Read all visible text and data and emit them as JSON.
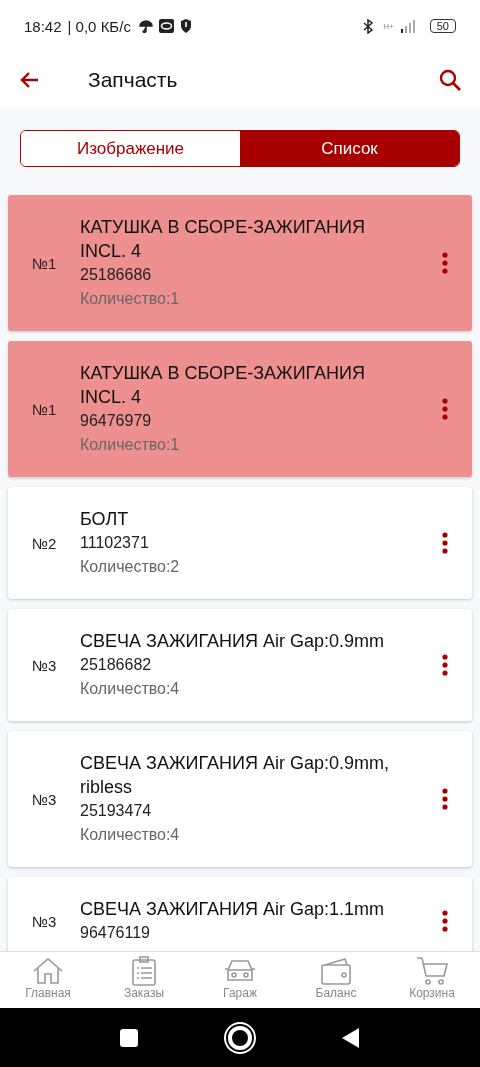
{
  "status_bar": {
    "time": "18:42",
    "speed": "| 0,0 КБ/с",
    "battery": "50",
    "network": "H+"
  },
  "app_bar": {
    "title": "Запчасть"
  },
  "tabs": [
    {
      "label": "Изображение",
      "selected": false
    },
    {
      "label": "Список",
      "selected": true
    }
  ],
  "parts": [
    {
      "number": "№1",
      "name": "КАТУШКА В СБОРЕ-ЗАЖИГАНИЯ INCL. 4",
      "code": "25186686",
      "quantity": "Количество:1",
      "highlighted": true
    },
    {
      "number": "№1",
      "name": "КАТУШКА В СБОРЕ-ЗАЖИГАНИЯ INCL. 4",
      "code": "96476979",
      "quantity": "Количество:1",
      "highlighted": true
    },
    {
      "number": "№2",
      "name": "БОЛТ",
      "code": "11102371",
      "quantity": "Количество:2",
      "highlighted": false
    },
    {
      "number": "№3",
      "name": "СВЕЧА ЗАЖИГАНИЯ Air Gap:0.9mm",
      "code": "25186682",
      "quantity": "Количество:4",
      "highlighted": false
    },
    {
      "number": "№3",
      "name": "СВЕЧА ЗАЖИГАНИЯ Air Gap:0.9mm, ribless",
      "code": "25193474",
      "quantity": "Количество:4",
      "highlighted": false
    },
    {
      "number": "№3",
      "name": "СВЕЧА ЗАЖИГАНИЯ Air Gap:1.1mm",
      "code": "96476119",
      "highlighted": false
    }
  ],
  "bottom_nav": [
    {
      "kind": "home",
      "label": "Главная"
    },
    {
      "kind": "orders",
      "label": "Заказы"
    },
    {
      "kind": "garage",
      "label": "Гараж"
    },
    {
      "kind": "balance",
      "label": "Баланс"
    },
    {
      "kind": "cart",
      "label": "Корзина"
    }
  ]
}
